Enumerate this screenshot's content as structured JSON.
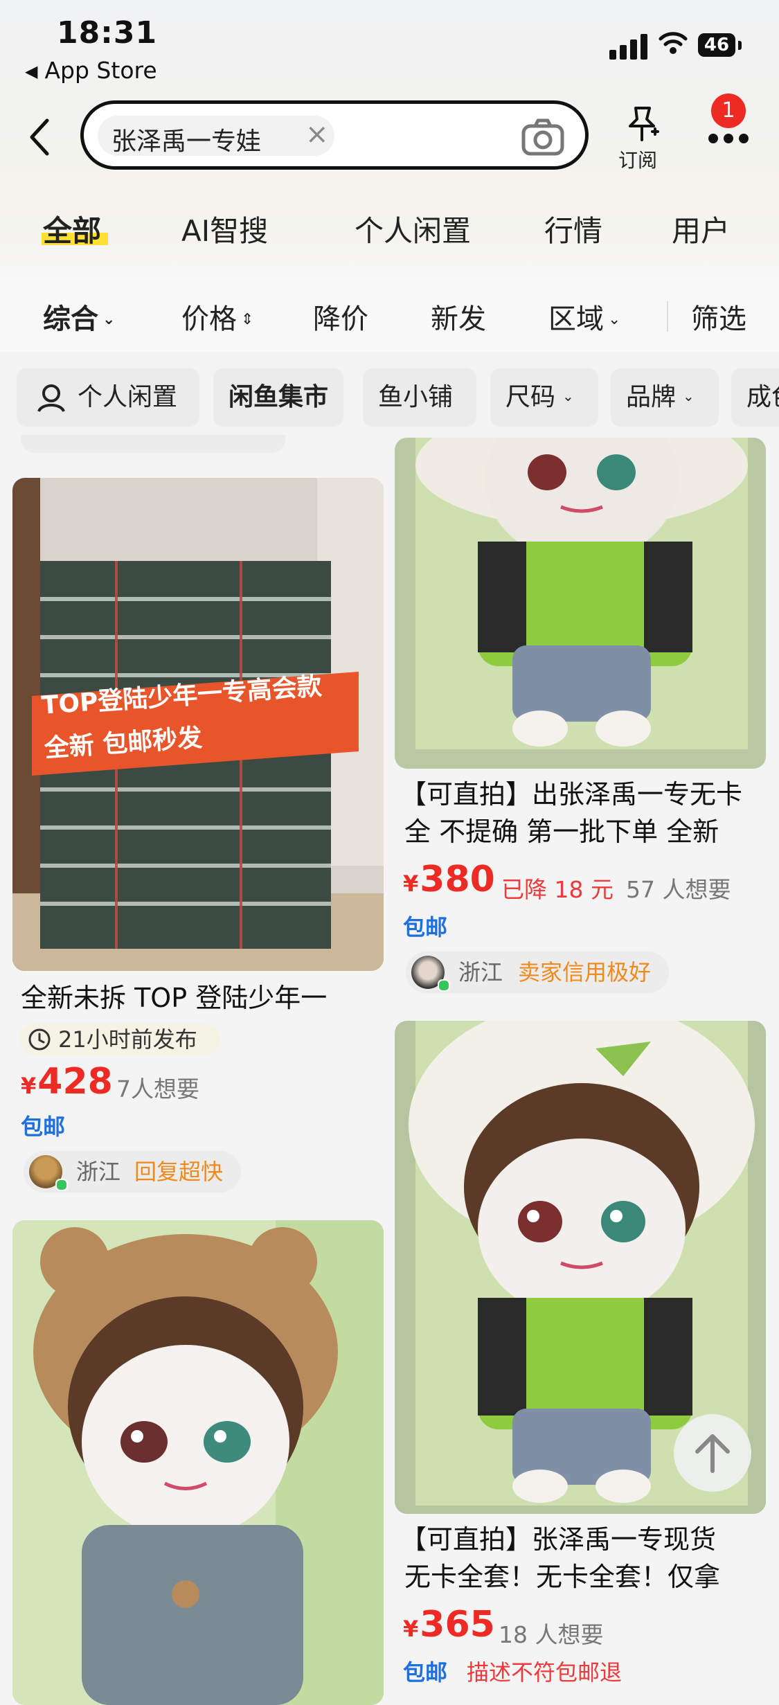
{
  "status_bar": {
    "time": "18:31",
    "back_app": "App Store",
    "battery": "46"
  },
  "search": {
    "query": "张泽禹一专娃",
    "subscribe_label": "订阅",
    "badge_count": "1"
  },
  "categories": [
    "全部",
    "AI智搜",
    "个人闲置",
    "行情",
    "用户"
  ],
  "sort": [
    "综合",
    "价格",
    "降价",
    "新发",
    "区域",
    "筛选"
  ],
  "chips": [
    "个人闲置",
    "闲鱼集市",
    "鱼小铺",
    "尺码",
    "品牌",
    "成色"
  ],
  "listings": [
    {
      "photo_text": [
        "TOP登陆少年一专高会款",
        "全新 包邮秒发"
      ],
      "title": "全新未拆 TOP 登陆少年一",
      "posted": "21小时前发布",
      "price_symbol": "¥",
      "price": "428",
      "want": "7人想要",
      "shipping": "包邮",
      "seller_location": "浙江",
      "seller_tag": "回复超快"
    },
    {
      "title_lines": [
        "【可直拍】出张泽禹一专无卡",
        "全 不提确 第一批下单 全新"
      ],
      "price_symbol": "¥",
      "price": "380",
      "price_drop": "已降 18 元",
      "want": "57 人想要",
      "shipping": "包邮",
      "seller_location": "浙江",
      "seller_tag": "卖家信用极好"
    },
    {
      "title_lines": [
        "【可直拍】张泽禹一专现货",
        "无卡全套！无卡全套！仅拿"
      ],
      "price_symbol": "¥",
      "price": "365",
      "want": "18 人想要",
      "shipping": "包邮",
      "extra_tag": "描述不符包邮退"
    }
  ],
  "colors": {
    "price_red": "#ee2a24",
    "free_blue": "#1e6fe0",
    "accent_yellow": "#ffe033",
    "tag_orange": "#f08a1c"
  }
}
